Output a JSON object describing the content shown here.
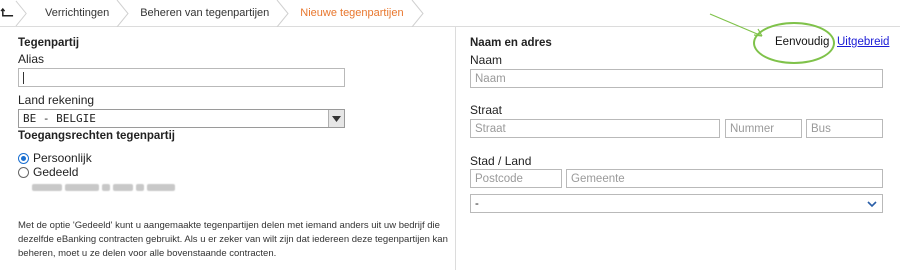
{
  "breadcrumb": {
    "items": [
      {
        "label": "Verrichtingen",
        "active": false
      },
      {
        "label": "Beheren van tegenpartijen",
        "active": false
      },
      {
        "label": "Nieuwe tegenpartijen",
        "active": true
      }
    ]
  },
  "left": {
    "section_title": "Tegenpartij",
    "alias_label": "Alias",
    "alias_value": "",
    "country_label": "Land rekening",
    "country_value": "BE - BELGIE",
    "access_title": "Toegangsrechten tegenpartij",
    "radio_personal": "Persoonlijk",
    "radio_shared": "Gedeeld",
    "radio_selected": "Persoonlijk",
    "note": "Met de optie 'Gedeeld' kunt u aangemaakte tegenpartijen delen met iemand anders uit uw bedrijf die dezelfde eBanking contracten gebruikt. Als u er zeker van wilt zijn dat iedereen deze tegenpartijen kan beheren, moet u ze delen voor alle bovenstaande contracten."
  },
  "right": {
    "section_title": "Naam en adres",
    "mode_simple": "Eenvoudig",
    "mode_extended": "Uitgebreid",
    "name_label": "Naam",
    "name_placeholder": "Naam",
    "street_label": "Straat",
    "street_placeholder": "Straat",
    "number_placeholder": "Nummer",
    "box_placeholder": "Bus",
    "city_label": "Stad / Land",
    "postcode_placeholder": "Postcode",
    "municipality_placeholder": "Gemeente",
    "country_value": "-"
  },
  "colors": {
    "accent": "#e8772e",
    "link": "#1a1ad6",
    "annotation": "#7fc24a",
    "radio": "#1a6fd1"
  }
}
